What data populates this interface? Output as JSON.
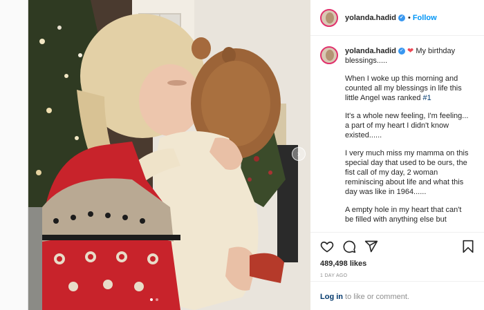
{
  "header": {
    "username": "yolanda.hadid",
    "verified_icon": "verified-badge-icon",
    "separator": "•",
    "follow_label": "Follow"
  },
  "caption": {
    "username": "yolanda.hadid",
    "heart_emoji": "❤",
    "first_line": "My birthday blessings.....",
    "para1_pre": "When I woke up this morning and counted all my blessings in life this little Angel was ranked ",
    "para1_tag": "#1",
    "para2": "It's a whole new feeling, I'm feeling... a part of my heart I didn't know existed......",
    "para3": "I very much miss my mamma on this special day that used to be ours, the fist call of my day, 2 woman reminiscing about life and what this day was like in 1964......",
    "para4": "A empty hole in my heart that can't be filled with anything else but"
  },
  "actions": {
    "like_icon": "heart-icon",
    "comment_icon": "comment-icon",
    "share_icon": "share-icon",
    "save_icon": "bookmark-icon",
    "likes": "489,498 likes",
    "time": "1 DAY AGO"
  },
  "login": {
    "link": "Log in",
    "rest": " to like or comment."
  },
  "media": {
    "next_glyph": "›",
    "carousel_count": 2,
    "carousel_active": 0
  },
  "colors": {
    "follow_blue": "#0095f6",
    "verified_blue": "#3897f0",
    "heart_red": "#ed4956",
    "sweater_red": "#c8232b"
  }
}
